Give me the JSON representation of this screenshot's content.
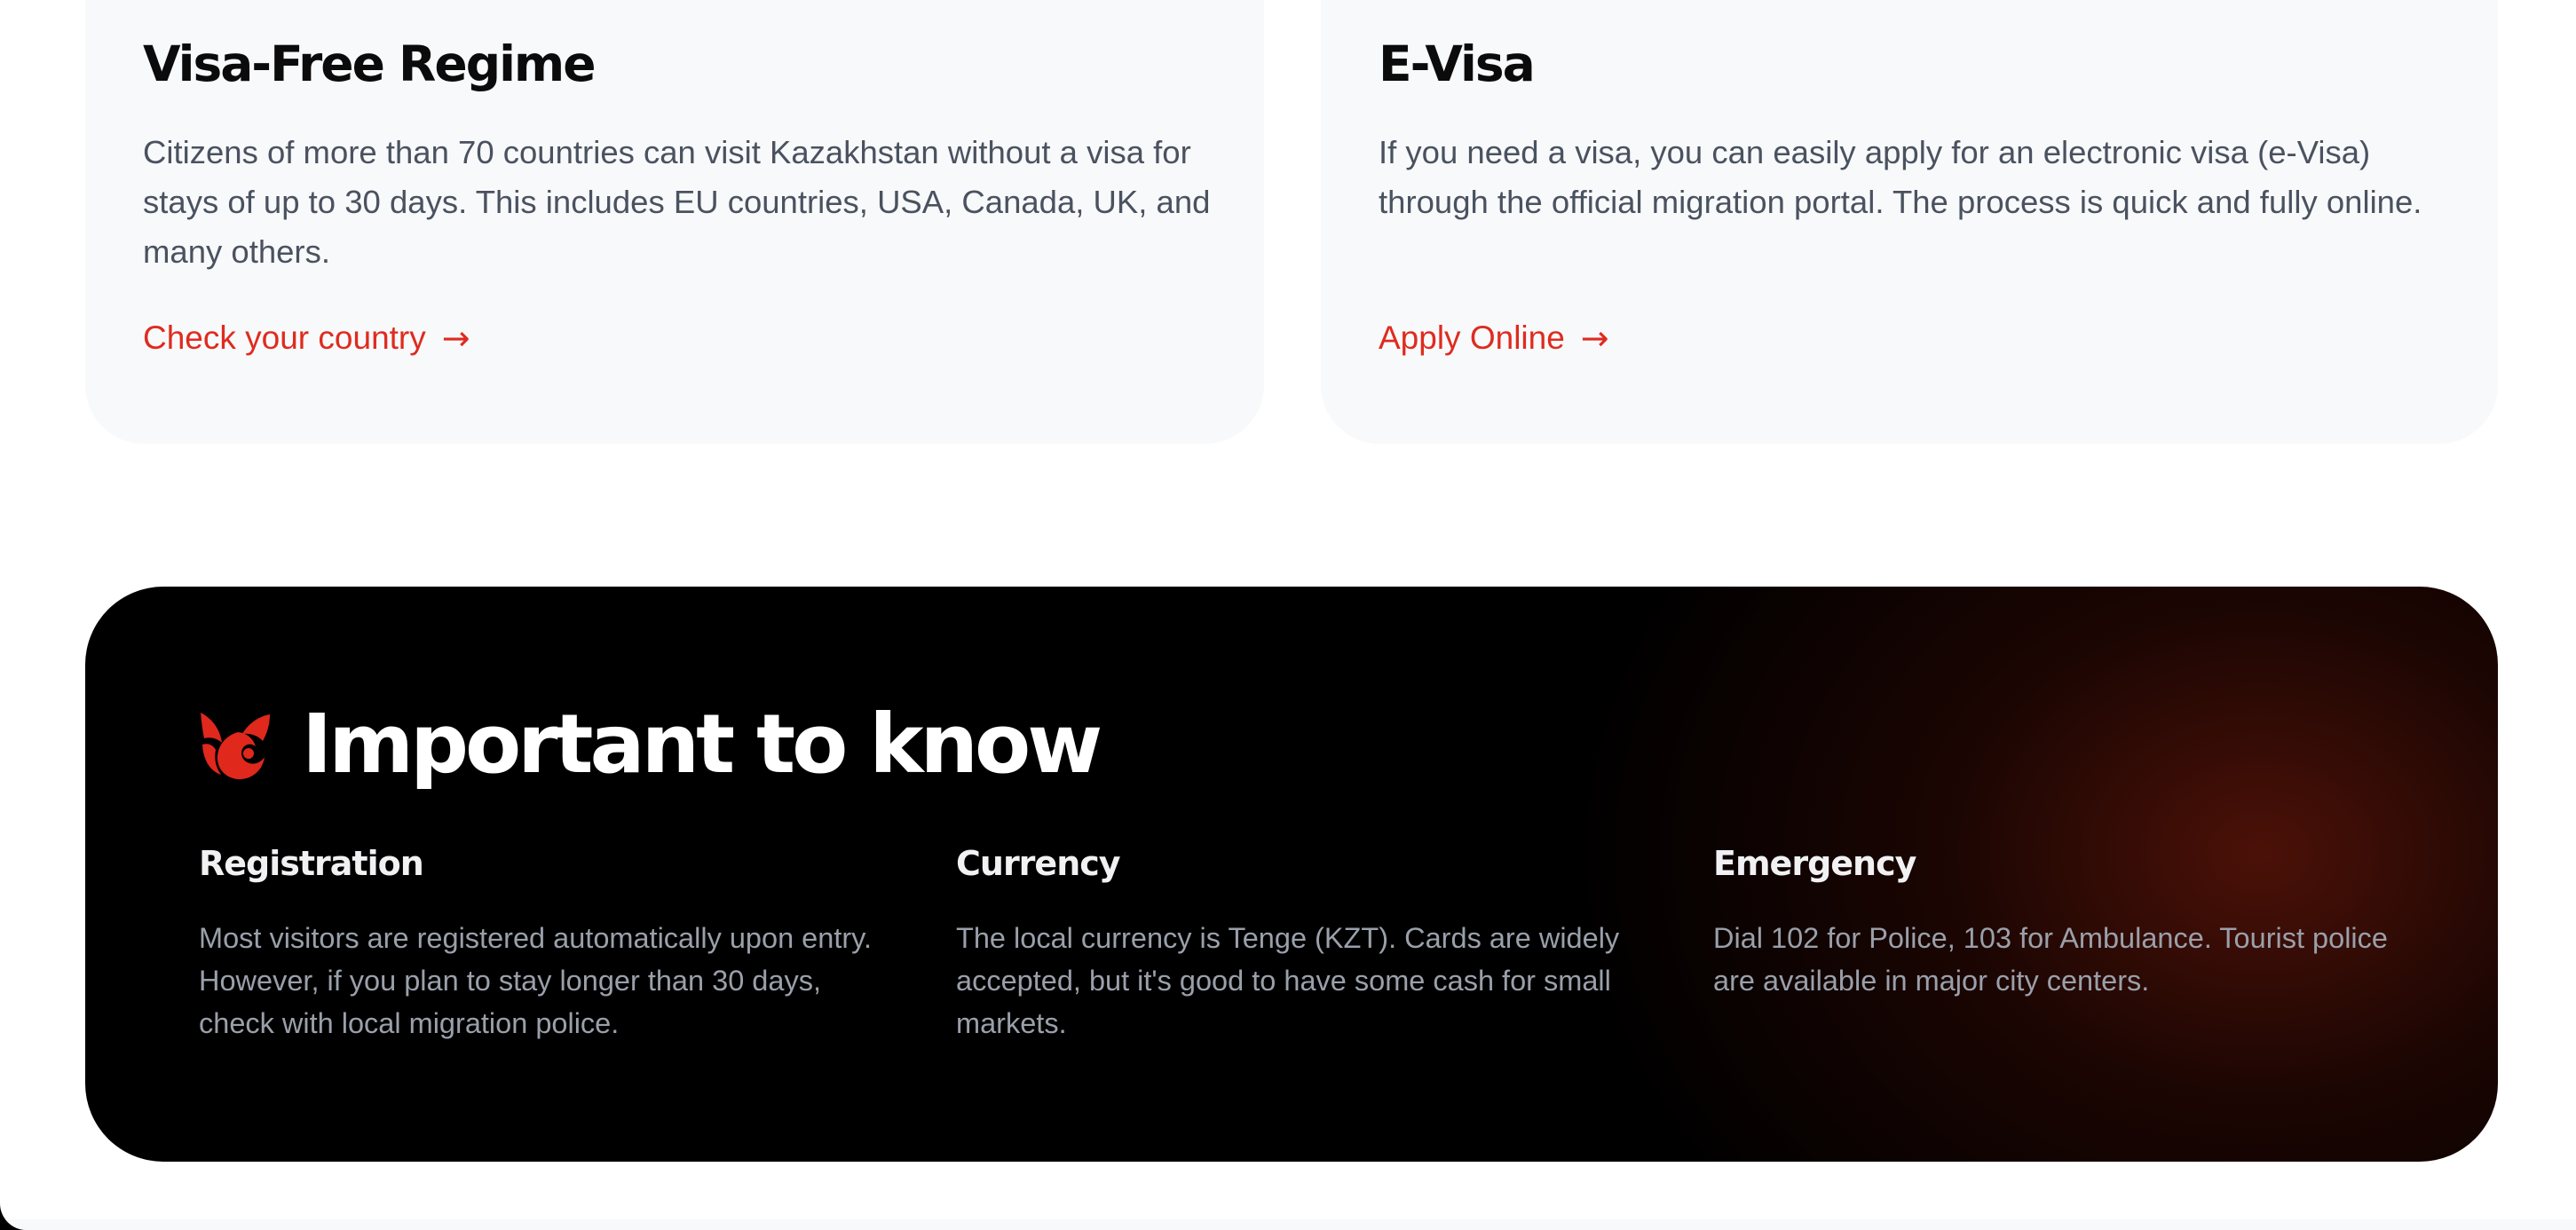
{
  "visa_cards": [
    {
      "title": "Visa-Free Regime",
      "text": "Citizens of more than 70 countries can visit Kazakhstan without a visa for stays of up to 30 days. This includes EU countries, USA, Canada, UK, and many others.",
      "link_label": "Check your country",
      "link_icon": "→"
    },
    {
      "title": "E-Visa",
      "text": "If you need a visa, you can easily apply for an electronic visa (e-Visa) through the official migration portal. The process is quick and fully online.",
      "link_label": "Apply Online",
      "link_icon": "→"
    }
  ],
  "important": {
    "logo_icon": "red-flame-logo-icon",
    "title": "Important to know",
    "items": [
      {
        "heading": "Registration",
        "text": "Most visitors are registered automatically upon entry. However, if you plan to stay longer than 30 days, check with local migration police."
      },
      {
        "heading": "Currency",
        "text": "The local currency is Tenge (KZT). Cards are widely accepted, but it's good to have some cash for small markets."
      },
      {
        "heading": "Emergency",
        "text": "Dial 102 for Police, 103 for Ambulance. Tourist police are available in major city centers."
      }
    ]
  },
  "colors": {
    "accent": "#df2b1f",
    "card_background": "#f8f9fa",
    "panel_background": "#000000",
    "panel_glow": "#60160a"
  }
}
